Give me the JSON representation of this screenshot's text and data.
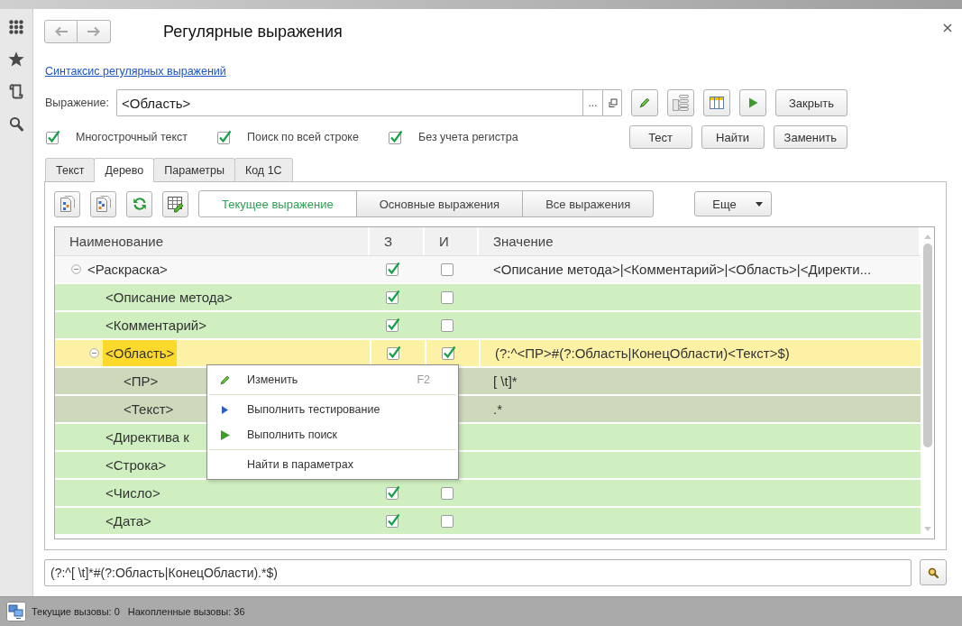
{
  "window": {
    "title": "Регулярные выражения"
  },
  "help_link": "Синтаксис регулярных выражений",
  "expression": {
    "label": "Выражение:",
    "value": "<Область>",
    "select_button": "..."
  },
  "close_button": "Закрыть",
  "options": [
    {
      "label": "Многострочный текст",
      "checked": true
    },
    {
      "label": "Поиск по всей строке",
      "checked": true
    },
    {
      "label": "Без учета регистра",
      "checked": true
    }
  ],
  "action_buttons": [
    "Тест",
    "Найти",
    "Заменить"
  ],
  "tabs": [
    {
      "label": "Текст",
      "selected": false
    },
    {
      "label": "Дерево",
      "selected": true
    },
    {
      "label": "Параметры",
      "selected": false
    },
    {
      "label": "Код 1С",
      "selected": false
    }
  ],
  "tree_panel": {
    "filters": [
      {
        "label": "Текущее выражение",
        "selected": true
      },
      {
        "label": "Основные выражения",
        "selected": false
      },
      {
        "label": "Все выражения",
        "selected": false
      }
    ],
    "more_button": "Еще",
    "table": {
      "columns": [
        "Наименование",
        "З",
        "И",
        "Значение"
      ],
      "rows": [
        {
          "name": "<Раскраска>",
          "expanded": true,
          "selected": false,
          "color": "#f8f8f8",
          "z_checked": true,
          "i_checked": false,
          "value": "<Описание метода>|<Комментарий>|<Область>|<Директи...",
          "children": [
            {
              "name": "<Описание метода>",
              "selected": false,
              "color": "#d0efc0",
              "z_checked": true,
              "i_checked": false
            },
            {
              "name": "<Комментарий>",
              "selected": false,
              "color": "#d0efc0",
              "z_checked": true,
              "i_checked": false
            },
            {
              "name": "<Область>",
              "expanded": true,
              "selected": true,
              "z_checked": true,
              "i_checked": true,
              "value": "(?:^<ПР>#(?:Область|КонецОбласти)<Текст>$)",
              "children": [
                {
                  "name": "<ПР>",
                  "selected": false,
                  "color": "#cdd9ba",
                  "value": "[ \\t]*"
                },
                {
                  "name": "<Текст>",
                  "selected": false,
                  "color": "#cdd9ba",
                  "value": ".*"
                }
              ]
            },
            {
              "name": "<Директива к",
              "selected": false,
              "color": "#d0efc0"
            },
            {
              "name": "<Строка>",
              "selected": false,
              "color": "#d0efc0"
            },
            {
              "name": "<Число>",
              "selected": false,
              "color": "#d0efc0",
              "z_checked": true,
              "i_checked": false
            },
            {
              "name": "<Дата>",
              "selected": false,
              "color": "#d0efc0",
              "z_checked": true,
              "i_checked": false
            }
          ]
        }
      ]
    },
    "context_menu": {
      "items": [
        {
          "kind": "edit",
          "label": "Изменить",
          "shortcut": "F2"
        },
        {
          "kind": "separator"
        },
        {
          "kind": "test",
          "label": "Выполнить тестирование"
        },
        {
          "kind": "search",
          "label": "Выполнить поиск"
        },
        {
          "kind": "separator"
        },
        {
          "kind": "plain",
          "label": "Найти в параметрах"
        }
      ]
    }
  },
  "result_field": {
    "value": "(?:^[ \\t]*#(?:Область|КонецОбласти).*$)"
  },
  "status_bar": {
    "items": [
      "Текущие вызовы: 0",
      "Накопленные вызовы: 36"
    ]
  }
}
